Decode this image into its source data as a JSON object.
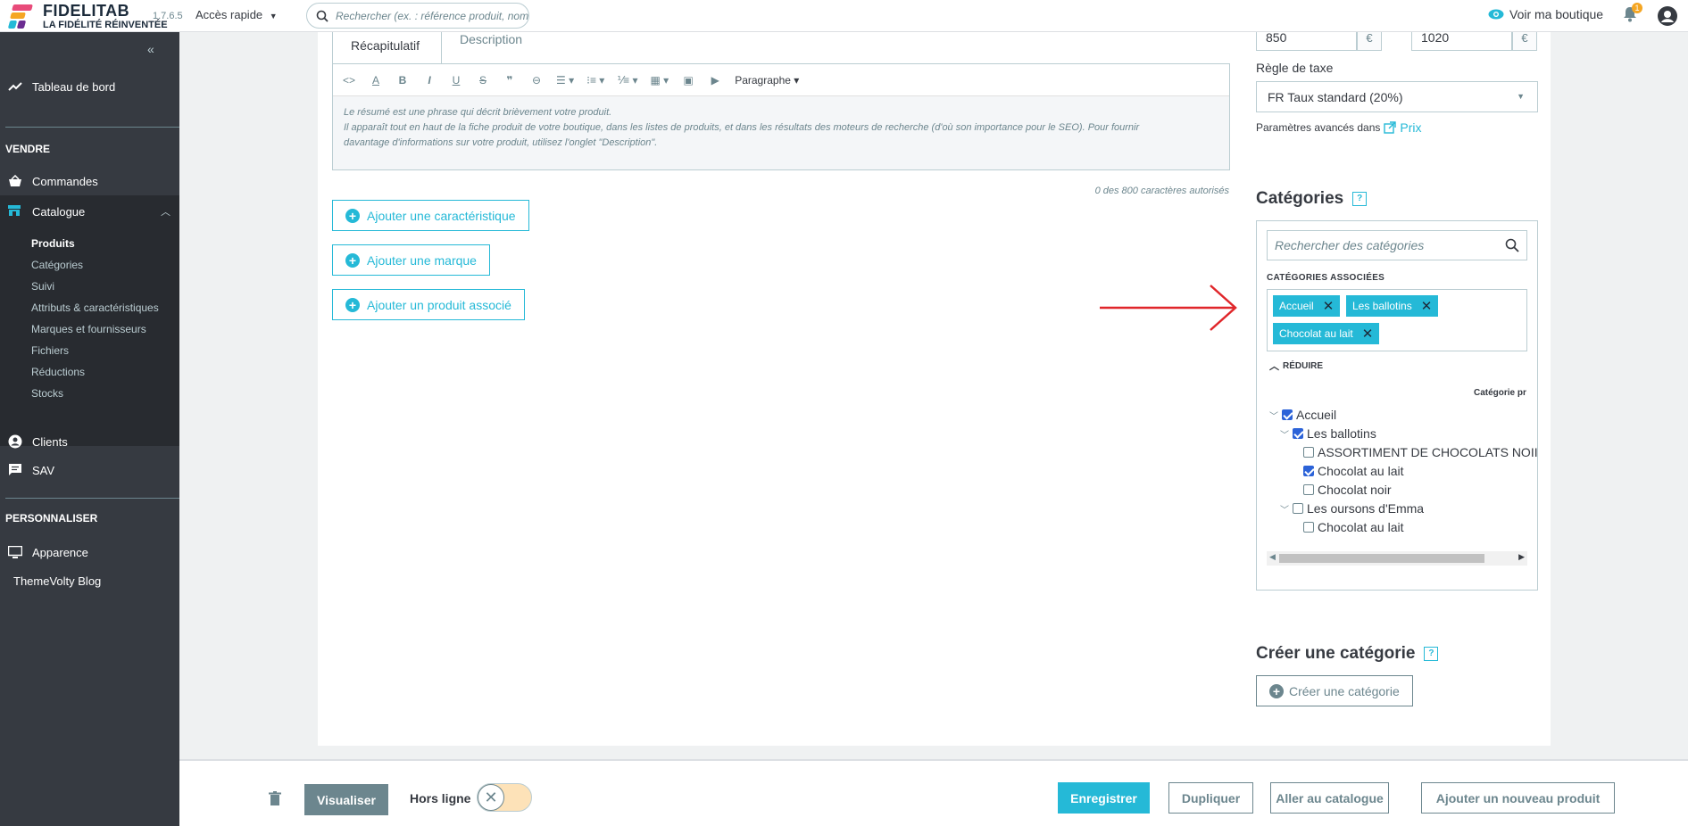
{
  "topbar": {
    "logo_title": "FIDELITAB",
    "logo_subtitle": "LA FIDÉLITÉ RÉINVENTÉE",
    "version": "1.7.6.5",
    "quick_access": "Accès rapide",
    "search_placeholder": "Rechercher (ex. : référence produit, nom",
    "view_shop": "Voir ma boutique",
    "notifications_count": "1"
  },
  "sidebar": {
    "dashboard": "Tableau de bord",
    "section_sell": "VENDRE",
    "orders": "Commandes",
    "catalog": "Catalogue",
    "catalog_items": [
      "Produits",
      "Catégories",
      "Suivi",
      "Attributs & caractéristiques",
      "Marques et fournisseurs",
      "Fichiers",
      "Réductions",
      "Stocks"
    ],
    "clients": "Clients",
    "sav": "SAV",
    "section_customize": "PERSONNALISER",
    "appearance": "Apparence",
    "blog": "ThemeVolty Blog"
  },
  "editor": {
    "tab_summary": "Récapitulatif",
    "tab_description": "Description",
    "paragraph_label": "Paragraphe",
    "help_line1": "Le résumé est une phrase qui décrit brièvement votre produit.",
    "help_line2": "Il apparaît tout en haut de la fiche produit de votre boutique, dans les listes de produits, et dans les résultats des moteurs de recherche (d'où son importance pour le SEO). Pour fournir",
    "help_line3": "davantage d'informations sur votre produit, utilisez l'onglet \"Description\".",
    "char_count": "0 des 800 caractères autorisés"
  },
  "actions": {
    "add_feature": "Ajouter une caractéristique",
    "add_brand": "Ajouter une marque",
    "add_related": "Ajouter un produit associé"
  },
  "pricing": {
    "price_ht": "850",
    "price_ttc": "1020",
    "currency": "€",
    "tax_rule_label": "Règle de taxe",
    "tax_rule_value": "FR Taux standard (20%)",
    "advanced_params": "Paramètres avancés dans",
    "price_link": "Prix"
  },
  "categories": {
    "title": "Catégories",
    "help": "?",
    "search_placeholder": "Rechercher des catégories",
    "associated_title": "CATÉGORIES ASSOCIÉES",
    "tags": [
      "Accueil",
      "Les ballotins",
      "Chocolat au lait"
    ],
    "reduce": "RÉDUIRE",
    "main_category_col": "Catégorie pr",
    "tree": [
      {
        "label": "Accueil",
        "checked": true
      },
      {
        "label": "Les ballotins",
        "checked": true
      },
      {
        "label": "ASSORTIMENT DE CHOCOLATS NOII",
        "checked": false
      },
      {
        "label": "Chocolat au lait",
        "checked": true
      },
      {
        "label": "Chocolat noir",
        "checked": false
      },
      {
        "label": "Les oursons d'Emma",
        "checked": false
      },
      {
        "label": "Chocolat au lait",
        "checked": false
      }
    ]
  },
  "create_category": {
    "title": "Créer une catégorie",
    "help": "?",
    "button": "Créer une catégorie"
  },
  "footer": {
    "preview": "Visualiser",
    "offline": "Hors ligne",
    "save": "Enregistrer",
    "duplicate": "Dupliquer",
    "go_catalog": "Aller au catalogue",
    "add_new": "Ajouter un nouveau produit"
  },
  "colors": {
    "accent": "#25b9d7",
    "sidebar": "#363a41",
    "arrow": "#e0262a"
  }
}
